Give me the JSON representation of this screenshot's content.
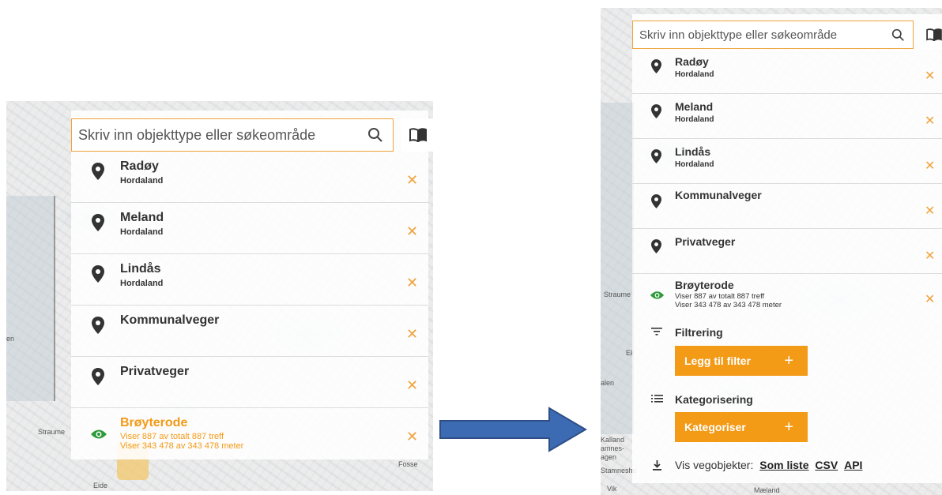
{
  "search": {
    "placeholder": "Skriv inn objekttype eller søkeområde"
  },
  "icons": {
    "search": "search-icon",
    "book": "book-icon",
    "pin": "location-pin-icon",
    "close": "close-icon",
    "eye": "eye-icon",
    "filter": "filter-icon",
    "list": "list-icon",
    "download": "download-icon",
    "arrow": "right-arrow"
  },
  "colors": {
    "accent": "#f39a16",
    "visible": "#2e9a3a",
    "arrow": "#3d6bb3"
  },
  "items": [
    {
      "title": "Radøy",
      "sub": "Hordaland"
    },
    {
      "title": "Meland",
      "sub": "Hordaland"
    },
    {
      "title": "Lindås",
      "sub": "Hordaland"
    },
    {
      "title": "Kommunalveger",
      "sub": ""
    },
    {
      "title": "Privatveger",
      "sub": ""
    },
    {
      "title": "Brøyterode",
      "line1": "Viser 887 av totalt 887 treff",
      "line2": "Viser 343 478 av 343 478 meter"
    }
  ],
  "filter": {
    "heading": "Filtrering",
    "button": "Legg til filter"
  },
  "category": {
    "heading": "Kategorisering",
    "button": "Kategoriser"
  },
  "plus": "+",
  "close": "✕",
  "footer": {
    "label": "Vis vegobjekter:",
    "links": [
      "Som liste",
      "CSV",
      "API"
    ]
  },
  "map_labels": {
    "left": [
      "Straume",
      "Eide",
      "Fosse",
      "en"
    ],
    "right": [
      "Straume",
      "Ek",
      "alen",
      "Kalland",
      "amnes-",
      "agen",
      "Stamneshe",
      "Vik",
      "Mæland"
    ]
  }
}
